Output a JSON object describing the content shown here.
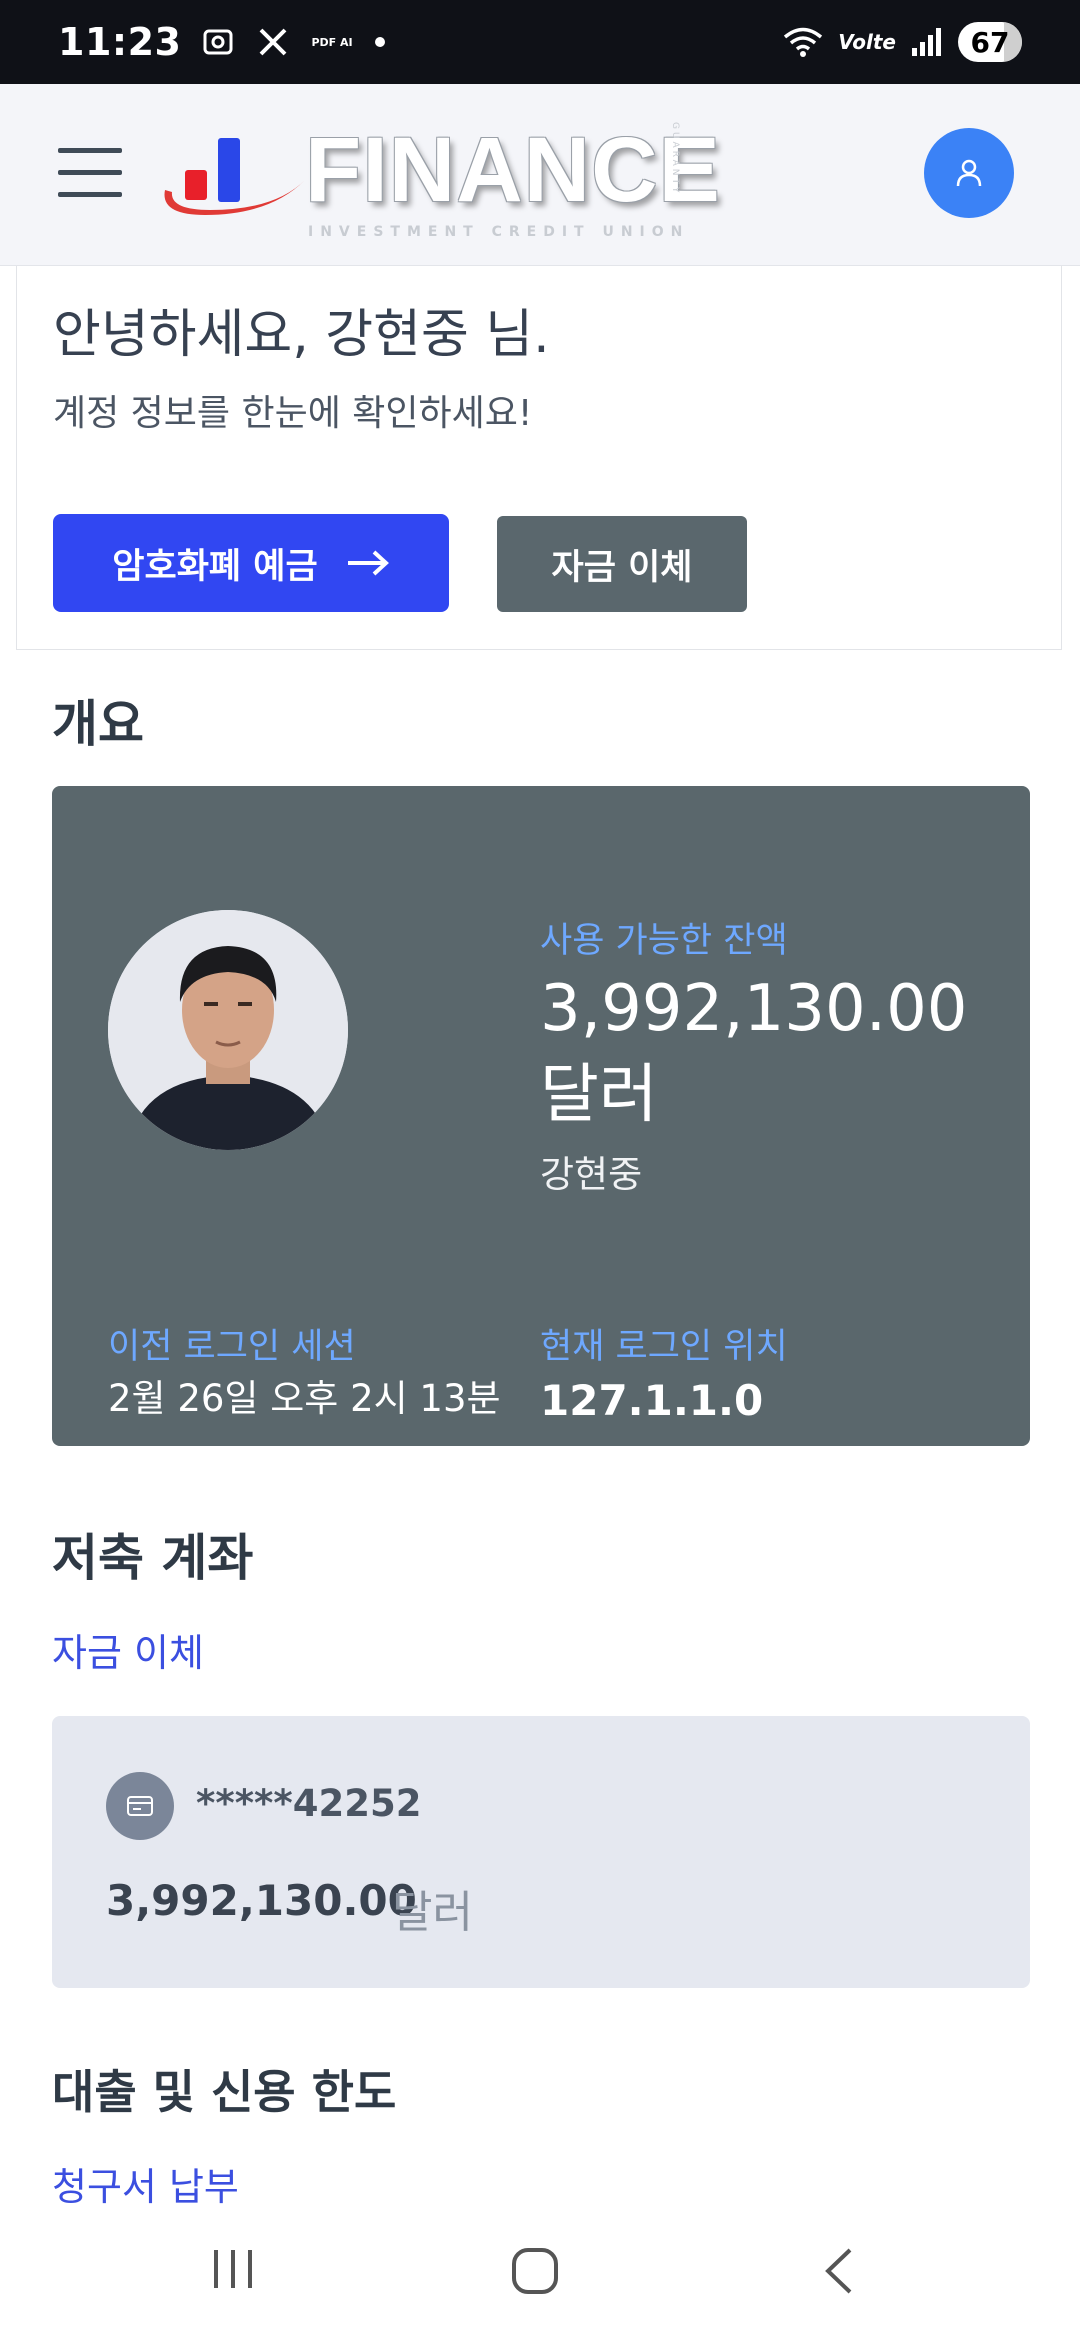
{
  "status_bar": {
    "time": "11:23",
    "pdf_label": "PDF AI",
    "network_label": "Volte",
    "battery": "67"
  },
  "header": {
    "logo_title": "FINANCE",
    "logo_subtitle": "INVESTMENT CREDIT UNION",
    "logo_side": "GUARANTY"
  },
  "welcome": {
    "greeting": "안녕하세요, 강현중 님.",
    "subtitle": "계정 정보를 한눈에 확인하세요!",
    "deposit_button": "암호화폐 예금",
    "transfer_button": "자금 이체"
  },
  "overview": {
    "section_title": "개요",
    "balance_label": "사용 가능한 잔액",
    "balance_value": "3,992,130.00달러",
    "account_holder": "강현중",
    "last_session_label": "이전 로그인 세션",
    "last_session_value": "2월 26일 오후 2시 13분",
    "location_label": "현재 로그인 위치",
    "location_value": "127.1.1.0"
  },
  "savings": {
    "section_title": "저축 계좌",
    "transfer_link": "자금 이체",
    "account_number": "*****42252",
    "amount": "3,992,130.00",
    "currency": "달러"
  },
  "loans": {
    "section_title": "대출 및 신용 한도",
    "bill_pay_link": "청구서 납부"
  },
  "colors": {
    "primary": "#3147f2",
    "card_dark": "#5a676c",
    "accent_label": "#6ea8ff",
    "avatar_blue": "#3b82f6"
  }
}
